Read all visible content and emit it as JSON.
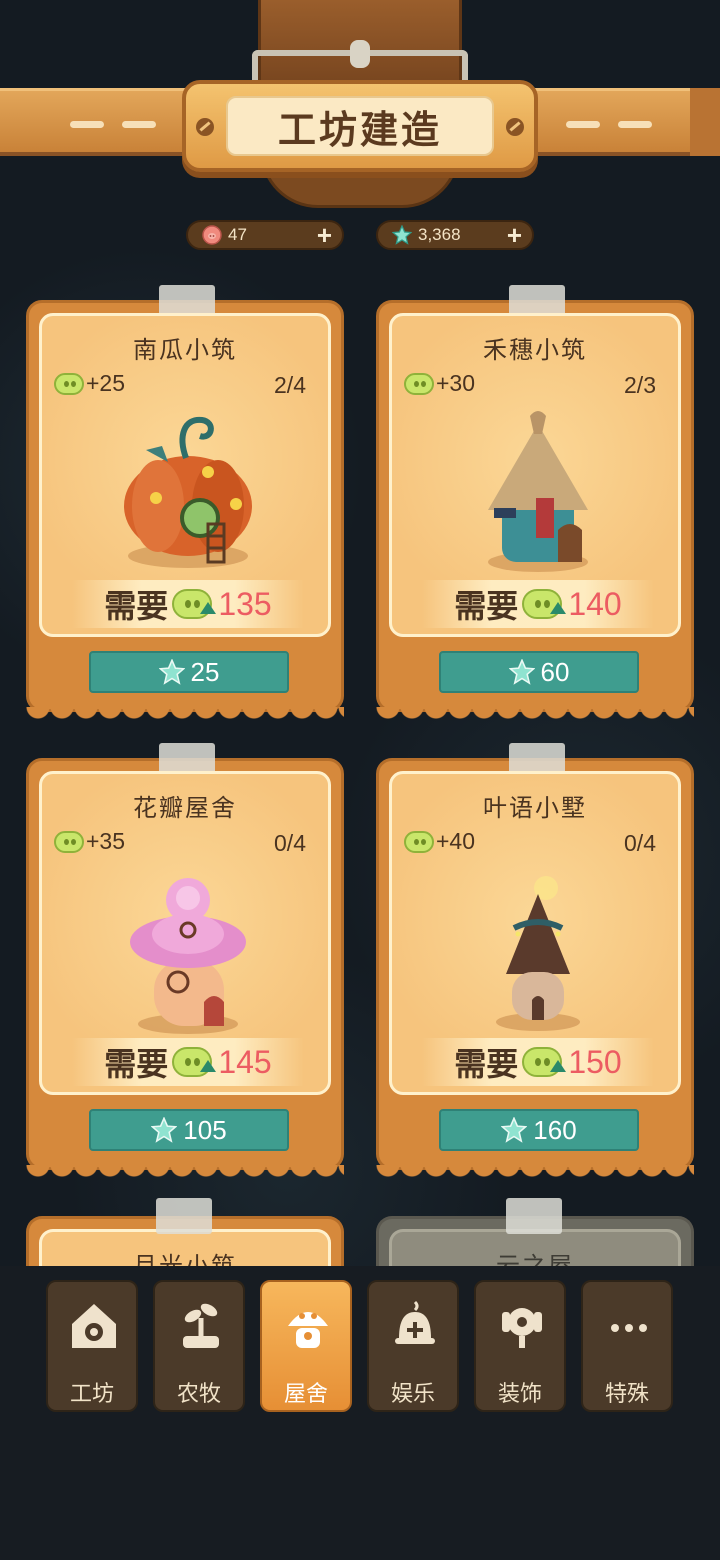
{
  "title": "工坊建造",
  "currencies": [
    {
      "icon": "pig-coin-icon",
      "value": "47",
      "add": "+"
    },
    {
      "icon": "star-gem-icon",
      "value": "3,368",
      "add": "+"
    }
  ],
  "buildings": [
    {
      "name": "南瓜小筑",
      "income": "+25",
      "count": "2/4",
      "require_label": "需要",
      "require_value": "135",
      "price": "25"
    },
    {
      "name": "禾穗小筑",
      "income": "+30",
      "count": "2/3",
      "require_label": "需要",
      "require_value": "140",
      "price": "60"
    },
    {
      "name": "花瓣屋舍",
      "income": "+35",
      "count": "0/4",
      "require_label": "需要",
      "require_value": "145",
      "price": "105"
    },
    {
      "name": "叶语小墅",
      "income": "+40",
      "count": "0/4",
      "require_label": "需要",
      "require_value": "150",
      "price": "160"
    }
  ],
  "partial_buildings": [
    {
      "name": "月光小筑"
    },
    {
      "name": "云之屋"
    }
  ],
  "tabs": [
    {
      "label": "工坊",
      "icon": "workshop-icon",
      "active": false
    },
    {
      "label": "农牧",
      "icon": "sprout-icon",
      "active": false
    },
    {
      "label": "屋舍",
      "icon": "mushroom-house-icon",
      "active": true
    },
    {
      "label": "娱乐",
      "icon": "bell-icon",
      "active": false
    },
    {
      "label": "装饰",
      "icon": "flower-deco-icon",
      "active": false
    },
    {
      "label": "特殊",
      "icon": "more-icon",
      "active": false
    }
  ],
  "colors": {
    "accent": "#e68f35",
    "buy_button": "#3f9d8f",
    "require_value": "#ec5c62",
    "card": "#d6893c"
  }
}
